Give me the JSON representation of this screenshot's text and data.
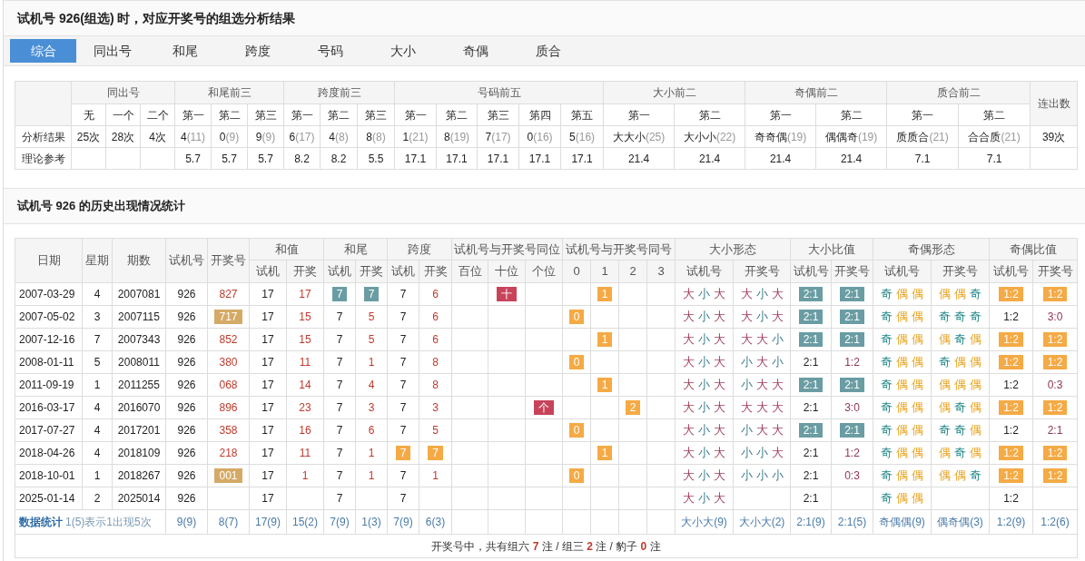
{
  "title": "试机号 926(组选) 时，对应开奖号的组选分析结果",
  "tabs": [
    {
      "label": "综合",
      "selected": true
    },
    {
      "label": "同出号",
      "selected": false
    },
    {
      "label": "和尾",
      "selected": false
    },
    {
      "label": "跨度",
      "selected": false
    },
    {
      "label": "号码",
      "selected": false
    },
    {
      "label": "大小",
      "selected": false
    },
    {
      "label": "奇偶",
      "selected": false
    },
    {
      "label": "质合",
      "selected": false
    }
  ],
  "summary": {
    "groups": [
      {
        "label": "同出号",
        "columns": [
          "无",
          "一个",
          "二个"
        ]
      },
      {
        "label": "和尾前三",
        "columns": [
          "第一",
          "第二",
          "第三"
        ]
      },
      {
        "label": "跨度前三",
        "columns": [
          "第一",
          "第二",
          "第三"
        ]
      },
      {
        "label": "号码前五",
        "columns": [
          "第一",
          "第二",
          "第三",
          "第四",
          "第五"
        ]
      },
      {
        "label": "大小前二",
        "columns": [
          "第一",
          "第二"
        ]
      },
      {
        "label": "奇偶前二",
        "columns": [
          "第一",
          "第二"
        ]
      },
      {
        "label": "质合前二",
        "columns": [
          "第一",
          "第二"
        ]
      }
    ],
    "side_header": "连出数",
    "rows": [
      {
        "label": "分析结果",
        "cells": [
          {
            "value": "25次"
          },
          {
            "value": "28次"
          },
          {
            "value": "4次"
          },
          {
            "value": "4",
            "count": "(11)"
          },
          {
            "value": "0",
            "count": "(9)"
          },
          {
            "value": "9",
            "count": "(9)"
          },
          {
            "value": "6",
            "count": "(17)"
          },
          {
            "value": "4",
            "count": "(8)"
          },
          {
            "value": "8",
            "count": "(8)"
          },
          {
            "value": "1",
            "count": "(21)"
          },
          {
            "value": "8",
            "count": "(19)"
          },
          {
            "value": "7",
            "count": "(17)"
          },
          {
            "value": "0",
            "count": "(16)"
          },
          {
            "value": "5",
            "count": "(16)"
          },
          {
            "value": "大大小",
            "count": "(25)"
          },
          {
            "value": "大小小",
            "count": "(22)"
          },
          {
            "value": "奇奇偶",
            "count": "(19)"
          },
          {
            "value": "偶偶奇",
            "count": "(19)"
          },
          {
            "value": "质质合",
            "count": "(21)"
          },
          {
            "value": "合合质",
            "count": "(21)"
          },
          {
            "value": "39次"
          }
        ]
      },
      {
        "label": "理论参考",
        "cells": [
          null,
          null,
          null,
          {
            "value": "5.7"
          },
          {
            "value": "5.7"
          },
          {
            "value": "5.7"
          },
          {
            "value": "8.2"
          },
          {
            "value": "8.2"
          },
          {
            "value": "5.5"
          },
          {
            "value": "17.1"
          },
          {
            "value": "17.1"
          },
          {
            "value": "17.1"
          },
          {
            "value": "17.1"
          },
          {
            "value": "17.1"
          },
          {
            "value": "21.4"
          },
          {
            "value": "21.4"
          },
          {
            "value": "21.4"
          },
          {
            "value": "21.4"
          },
          {
            "value": "7.1"
          },
          {
            "value": "7.1"
          },
          null
        ]
      }
    ]
  },
  "history_title": "试机号 926 的历史出现情况统计",
  "history": {
    "column_groups": [
      {
        "label": "日期"
      },
      {
        "label": "星期"
      },
      {
        "label": "期数"
      },
      {
        "label": "试机号"
      },
      {
        "label": "开奖号"
      },
      {
        "label": "和值",
        "children": [
          {
            "label": "试机"
          },
          {
            "label": "开奖"
          }
        ]
      },
      {
        "label": "和尾",
        "children": [
          {
            "label": "试机"
          },
          {
            "label": "开奖"
          }
        ]
      },
      {
        "label": "跨度",
        "children": [
          {
            "label": "试机"
          },
          {
            "label": "开奖"
          }
        ]
      },
      {
        "label": "试机号与开奖号同位",
        "children": [
          {
            "label": "百位"
          },
          {
            "label": "十位"
          },
          {
            "label": "个位"
          }
        ]
      },
      {
        "label": "试机号与开奖号同号",
        "children": [
          {
            "label": "0"
          },
          {
            "label": "1"
          },
          {
            "label": "2"
          },
          {
            "label": "3"
          }
        ]
      },
      {
        "label": "大小形态",
        "children": [
          {
            "label": "试机号"
          },
          {
            "label": "开奖号"
          }
        ]
      },
      {
        "label": "大小比值",
        "children": [
          {
            "label": "试机号"
          },
          {
            "label": "开奖号"
          }
        ]
      },
      {
        "label": "奇偶形态",
        "children": [
          {
            "label": "试机号"
          },
          {
            "label": "开奖号"
          }
        ]
      },
      {
        "label": "奇偶比值",
        "children": [
          {
            "label": "试机号"
          },
          {
            "label": "开奖号"
          }
        ]
      }
    ],
    "rows": [
      {
        "cells": [
          {
            "text": "2007-03-29"
          },
          {
            "text": "4"
          },
          {
            "text": "2007081"
          },
          {
            "text": "926"
          },
          {
            "text": "827"
          },
          {
            "text": "17"
          },
          {
            "text": "17"
          },
          {
            "text": "7",
            "color": "#6a9da3"
          },
          {
            "text": "7",
            "color": "#6a9da3"
          },
          {
            "text": "7"
          },
          {
            "text": "6"
          },
          null,
          {
            "text": "十",
            "color": "#c8435a"
          },
          null,
          null,
          {
            "text": "1",
            "color": "#f5aa45"
          },
          null,
          null,
          {
            "chars": [
              {
                "text": "大",
                "kind": "big"
              },
              {
                "text": "小",
                "kind": "small"
              },
              {
                "text": "大",
                "kind": "big"
              }
            ]
          },
          {
            "chars": [
              {
                "text": "大",
                "kind": "big"
              },
              {
                "text": "小",
                "kind": "small"
              },
              {
                "text": "大",
                "kind": "big"
              }
            ]
          },
          {
            "text": "2:1",
            "color": "#6a9da3"
          },
          {
            "text": "2:1",
            "color": "#6a9da3"
          },
          {
            "chars": [
              {
                "text": "奇",
                "kind": "odd"
              },
              {
                "text": "偶",
                "kind": "even"
              },
              {
                "text": "偶",
                "kind": "even"
              }
            ]
          },
          {
            "chars": [
              {
                "text": "偶",
                "kind": "even"
              },
              {
                "text": "偶",
                "kind": "even"
              },
              {
                "text": "奇",
                "kind": "odd"
              }
            ]
          },
          {
            "text": "1:2",
            "color": "#f5aa45"
          },
          {
            "text": "1:2",
            "color": "#f5aa45"
          }
        ]
      },
      {
        "cells": [
          {
            "text": "2007-05-02"
          },
          {
            "text": "3"
          },
          {
            "text": "2007115"
          },
          {
            "text": "926"
          },
          {
            "text": "717",
            "color": "#d5aa66"
          },
          {
            "text": "17"
          },
          {
            "text": "15"
          },
          {
            "text": "7"
          },
          {
            "text": "5"
          },
          {
            "text": "7"
          },
          {
            "text": "6"
          },
          null,
          null,
          null,
          {
            "text": "0",
            "color": "#f5aa45"
          },
          null,
          null,
          null,
          {
            "chars": [
              {
                "text": "大",
                "kind": "big"
              },
              {
                "text": "小",
                "kind": "small"
              },
              {
                "text": "大",
                "kind": "big"
              }
            ]
          },
          {
            "chars": [
              {
                "text": "大",
                "kind": "big"
              },
              {
                "text": "小",
                "kind": "small"
              },
              {
                "text": "大",
                "kind": "big"
              }
            ]
          },
          {
            "text": "2:1",
            "color": "#6a9da3"
          },
          {
            "text": "2:1",
            "color": "#6a9da3"
          },
          {
            "chars": [
              {
                "text": "奇",
                "kind": "odd"
              },
              {
                "text": "偶",
                "kind": "even"
              },
              {
                "text": "偶",
                "kind": "even"
              }
            ]
          },
          {
            "chars": [
              {
                "text": "奇",
                "kind": "odd"
              },
              {
                "text": "奇",
                "kind": "odd"
              },
              {
                "text": "奇",
                "kind": "odd"
              }
            ]
          },
          {
            "text": "1:2"
          },
          {
            "text": "3:0"
          }
        ]
      },
      {
        "cells": [
          {
            "text": "2007-12-16"
          },
          {
            "text": "7"
          },
          {
            "text": "2007343"
          },
          {
            "text": "926"
          },
          {
            "text": "852"
          },
          {
            "text": "17"
          },
          {
            "text": "15"
          },
          {
            "text": "7"
          },
          {
            "text": "5"
          },
          {
            "text": "7"
          },
          {
            "text": "6"
          },
          null,
          null,
          null,
          null,
          {
            "text": "1",
            "color": "#f5aa45"
          },
          null,
          null,
          {
            "chars": [
              {
                "text": "大",
                "kind": "big"
              },
              {
                "text": "小",
                "kind": "small"
              },
              {
                "text": "大",
                "kind": "big"
              }
            ]
          },
          {
            "chars": [
              {
                "text": "大",
                "kind": "big"
              },
              {
                "text": "大",
                "kind": "big"
              },
              {
                "text": "小",
                "kind": "small"
              }
            ]
          },
          {
            "text": "2:1",
            "color": "#6a9da3"
          },
          {
            "text": "2:1",
            "color": "#6a9da3"
          },
          {
            "chars": [
              {
                "text": "奇",
                "kind": "odd"
              },
              {
                "text": "偶",
                "kind": "even"
              },
              {
                "text": "偶",
                "kind": "even"
              }
            ]
          },
          {
            "chars": [
              {
                "text": "偶",
                "kind": "even"
              },
              {
                "text": "奇",
                "kind": "odd"
              },
              {
                "text": "偶",
                "kind": "even"
              }
            ]
          },
          {
            "text": "1:2",
            "color": "#f5aa45"
          },
          {
            "text": "1:2",
            "color": "#f5aa45"
          }
        ]
      },
      {
        "cells": [
          {
            "text": "2008-01-11"
          },
          {
            "text": "5"
          },
          {
            "text": "2008011"
          },
          {
            "text": "926"
          },
          {
            "text": "380"
          },
          {
            "text": "17"
          },
          {
            "text": "11"
          },
          {
            "text": "7"
          },
          {
            "text": "1"
          },
          {
            "text": "7"
          },
          {
            "text": "8"
          },
          null,
          null,
          null,
          {
            "text": "0",
            "color": "#f5aa45"
          },
          null,
          null,
          null,
          {
            "chars": [
              {
                "text": "大",
                "kind": "big"
              },
              {
                "text": "小",
                "kind": "small"
              },
              {
                "text": "大",
                "kind": "big"
              }
            ]
          },
          {
            "chars": [
              {
                "text": "小",
                "kind": "small"
              },
              {
                "text": "大",
                "kind": "big"
              },
              {
                "text": "小",
                "kind": "small"
              }
            ]
          },
          {
            "text": "2:1"
          },
          {
            "text": "1:2"
          },
          {
            "chars": [
              {
                "text": "奇",
                "kind": "odd"
              },
              {
                "text": "偶",
                "kind": "even"
              },
              {
                "text": "偶",
                "kind": "even"
              }
            ]
          },
          {
            "chars": [
              {
                "text": "奇",
                "kind": "odd"
              },
              {
                "text": "偶",
                "kind": "even"
              },
              {
                "text": "偶",
                "kind": "even"
              }
            ]
          },
          {
            "text": "1:2",
            "color": "#f5aa45"
          },
          {
            "text": "1:2",
            "color": "#f5aa45"
          }
        ]
      },
      {
        "cells": [
          {
            "text": "2011-09-19"
          },
          {
            "text": "1"
          },
          {
            "text": "2011255"
          },
          {
            "text": "926"
          },
          {
            "text": "068"
          },
          {
            "text": "17"
          },
          {
            "text": "14"
          },
          {
            "text": "7"
          },
          {
            "text": "4"
          },
          {
            "text": "7"
          },
          {
            "text": "8"
          },
          null,
          null,
          null,
          null,
          {
            "text": "1",
            "color": "#f5aa45"
          },
          null,
          null,
          {
            "chars": [
              {
                "text": "大",
                "kind": "big"
              },
              {
                "text": "小",
                "kind": "small"
              },
              {
                "text": "大",
                "kind": "big"
              }
            ]
          },
          {
            "chars": [
              {
                "text": "小",
                "kind": "small"
              },
              {
                "text": "大",
                "kind": "big"
              },
              {
                "text": "大",
                "kind": "big"
              }
            ]
          },
          {
            "text": "2:1",
            "color": "#6a9da3"
          },
          {
            "text": "2:1",
            "color": "#6a9da3"
          },
          {
            "chars": [
              {
                "text": "奇",
                "kind": "odd"
              },
              {
                "text": "偶",
                "kind": "even"
              },
              {
                "text": "偶",
                "kind": "even"
              }
            ]
          },
          {
            "chars": [
              {
                "text": "偶",
                "kind": "even"
              },
              {
                "text": "偶",
                "kind": "even"
              },
              {
                "text": "偶",
                "kind": "even"
              }
            ]
          },
          {
            "text": "1:2"
          },
          {
            "text": "0:3"
          }
        ]
      },
      {
        "cells": [
          {
            "text": "2016-03-17"
          },
          {
            "text": "4"
          },
          {
            "text": "2016070"
          },
          {
            "text": "926"
          },
          {
            "text": "896"
          },
          {
            "text": "17"
          },
          {
            "text": "23"
          },
          {
            "text": "7"
          },
          {
            "text": "3"
          },
          {
            "text": "7"
          },
          {
            "text": "3"
          },
          null,
          null,
          {
            "text": "个",
            "color": "#c8435a"
          },
          null,
          null,
          {
            "text": "2",
            "color": "#f5aa45"
          },
          null,
          {
            "chars": [
              {
                "text": "大",
                "kind": "big"
              },
              {
                "text": "小",
                "kind": "small"
              },
              {
                "text": "大",
                "kind": "big"
              }
            ]
          },
          {
            "chars": [
              {
                "text": "大",
                "kind": "big"
              },
              {
                "text": "大",
                "kind": "big"
              },
              {
                "text": "大",
                "kind": "big"
              }
            ]
          },
          {
            "text": "2:1"
          },
          {
            "text": "3:0"
          },
          {
            "chars": [
              {
                "text": "奇",
                "kind": "odd"
              },
              {
                "text": "偶",
                "kind": "even"
              },
              {
                "text": "偶",
                "kind": "even"
              }
            ]
          },
          {
            "chars": [
              {
                "text": "偶",
                "kind": "even"
              },
              {
                "text": "奇",
                "kind": "odd"
              },
              {
                "text": "偶",
                "kind": "even"
              }
            ]
          },
          {
            "text": "1:2",
            "color": "#f5aa45"
          },
          {
            "text": "1:2",
            "color": "#f5aa45"
          }
        ]
      },
      {
        "cells": [
          {
            "text": "2017-07-27"
          },
          {
            "text": "4"
          },
          {
            "text": "2017201"
          },
          {
            "text": "926"
          },
          {
            "text": "358"
          },
          {
            "text": "17"
          },
          {
            "text": "16"
          },
          {
            "text": "7"
          },
          {
            "text": "6"
          },
          {
            "text": "7"
          },
          {
            "text": "5"
          },
          null,
          null,
          null,
          {
            "text": "0",
            "color": "#f5aa45"
          },
          null,
          null,
          null,
          {
            "chars": [
              {
                "text": "大",
                "kind": "big"
              },
              {
                "text": "小",
                "kind": "small"
              },
              {
                "text": "大",
                "kind": "big"
              }
            ]
          },
          {
            "chars": [
              {
                "text": "小",
                "kind": "small"
              },
              {
                "text": "大",
                "kind": "big"
              },
              {
                "text": "大",
                "kind": "big"
              }
            ]
          },
          {
            "text": "2:1",
            "color": "#6a9da3"
          },
          {
            "text": "2:1",
            "color": "#6a9da3"
          },
          {
            "chars": [
              {
                "text": "奇",
                "kind": "odd"
              },
              {
                "text": "偶",
                "kind": "even"
              },
              {
                "text": "偶",
                "kind": "even"
              }
            ]
          },
          {
            "chars": [
              {
                "text": "奇",
                "kind": "odd"
              },
              {
                "text": "奇",
                "kind": "odd"
              },
              {
                "text": "偶",
                "kind": "even"
              }
            ]
          },
          {
            "text": "1:2"
          },
          {
            "text": "2:1"
          }
        ]
      },
      {
        "cells": [
          {
            "text": "2018-04-26"
          },
          {
            "text": "4"
          },
          {
            "text": "2018109"
          },
          {
            "text": "926"
          },
          {
            "text": "218"
          },
          {
            "text": "17"
          },
          {
            "text": "11"
          },
          {
            "text": "7"
          },
          {
            "text": "1"
          },
          {
            "text": "7",
            "color": "#f5aa45"
          },
          {
            "text": "7",
            "color": "#f5aa45"
          },
          null,
          null,
          null,
          null,
          {
            "text": "1",
            "color": "#f5aa45"
          },
          null,
          null,
          {
            "chars": [
              {
                "text": "大",
                "kind": "big"
              },
              {
                "text": "小",
                "kind": "small"
              },
              {
                "text": "大",
                "kind": "big"
              }
            ]
          },
          {
            "chars": [
              {
                "text": "小",
                "kind": "small"
              },
              {
                "text": "小",
                "kind": "small"
              },
              {
                "text": "大",
                "kind": "big"
              }
            ]
          },
          {
            "text": "2:1"
          },
          {
            "text": "1:2"
          },
          {
            "chars": [
              {
                "text": "奇",
                "kind": "odd"
              },
              {
                "text": "偶",
                "kind": "even"
              },
              {
                "text": "偶",
                "kind": "even"
              }
            ]
          },
          {
            "chars": [
              {
                "text": "偶",
                "kind": "even"
              },
              {
                "text": "奇",
                "kind": "odd"
              },
              {
                "text": "偶",
                "kind": "even"
              }
            ]
          },
          {
            "text": "1:2",
            "color": "#f5aa45"
          },
          {
            "text": "1:2",
            "color": "#f5aa45"
          }
        ]
      },
      {
        "cells": [
          {
            "text": "2018-10-01"
          },
          {
            "text": "1"
          },
          {
            "text": "2018267"
          },
          {
            "text": "926"
          },
          {
            "text": "001",
            "color": "#d5aa66"
          },
          {
            "text": "17"
          },
          {
            "text": "1"
          },
          {
            "text": "7"
          },
          {
            "text": "1"
          },
          {
            "text": "7"
          },
          {
            "text": "1"
          },
          null,
          null,
          null,
          {
            "text": "0",
            "color": "#f5aa45"
          },
          null,
          null,
          null,
          {
            "chars": [
              {
                "text": "大",
                "kind": "big"
              },
              {
                "text": "小",
                "kind": "small"
              },
              {
                "text": "大",
                "kind": "big"
              }
            ]
          },
          {
            "chars": [
              {
                "text": "小",
                "kind": "small"
              },
              {
                "text": "小",
                "kind": "small"
              },
              {
                "text": "小",
                "kind": "small"
              }
            ]
          },
          {
            "text": "2:1"
          },
          {
            "text": "0:3"
          },
          {
            "chars": [
              {
                "text": "奇",
                "kind": "odd"
              },
              {
                "text": "偶",
                "kind": "even"
              },
              {
                "text": "偶",
                "kind": "even"
              }
            ]
          },
          {
            "chars": [
              {
                "text": "偶",
                "kind": "even"
              },
              {
                "text": "偶",
                "kind": "even"
              },
              {
                "text": "奇",
                "kind": "odd"
              }
            ]
          },
          {
            "text": "1:2",
            "color": "#f5aa45"
          },
          {
            "text": "1:2",
            "color": "#f5aa45"
          }
        ]
      },
      {
        "cells": [
          {
            "text": "2025-01-14"
          },
          {
            "text": "2"
          },
          {
            "text": "2025014"
          },
          {
            "text": "926"
          },
          null,
          {
            "text": "17"
          },
          null,
          {
            "text": "7"
          },
          null,
          {
            "text": "7"
          },
          null,
          null,
          null,
          null,
          null,
          null,
          null,
          null,
          {
            "chars": [
              {
                "text": "大",
                "kind": "big"
              },
              {
                "text": "小",
                "kind": "small"
              },
              {
                "text": "大",
                "kind": "big"
              }
            ]
          },
          null,
          {
            "text": "2:1"
          },
          null,
          {
            "chars": [
              {
                "text": "奇",
                "kind": "odd"
              },
              {
                "text": "偶",
                "kind": "even"
              },
              {
                "text": "偶",
                "kind": "even"
              }
            ]
          },
          null,
          {
            "text": "1:2"
          },
          null
        ]
      }
    ],
    "stats": {
      "label": "数据统计",
      "note": "1(5)表示1出现5次",
      "cells": [
        "9(9)",
        "8(7)",
        "17(9)",
        "15(2)",
        "7(9)",
        "1(3)",
        "7(9)",
        "6(3)",
        null,
        null,
        null,
        null,
        null,
        null,
        null,
        "大小大(9)",
        "大小大(2)",
        "2:1(9)",
        "2:1(5)",
        "奇偶偶(9)",
        "偶奇偶(3)",
        "1:2(9)",
        "1:2(6)"
      ]
    },
    "footer": "开奖号中，共有组六 **7** 注 / 组三 **2** 注 / 豹子 **0** 注"
  }
}
